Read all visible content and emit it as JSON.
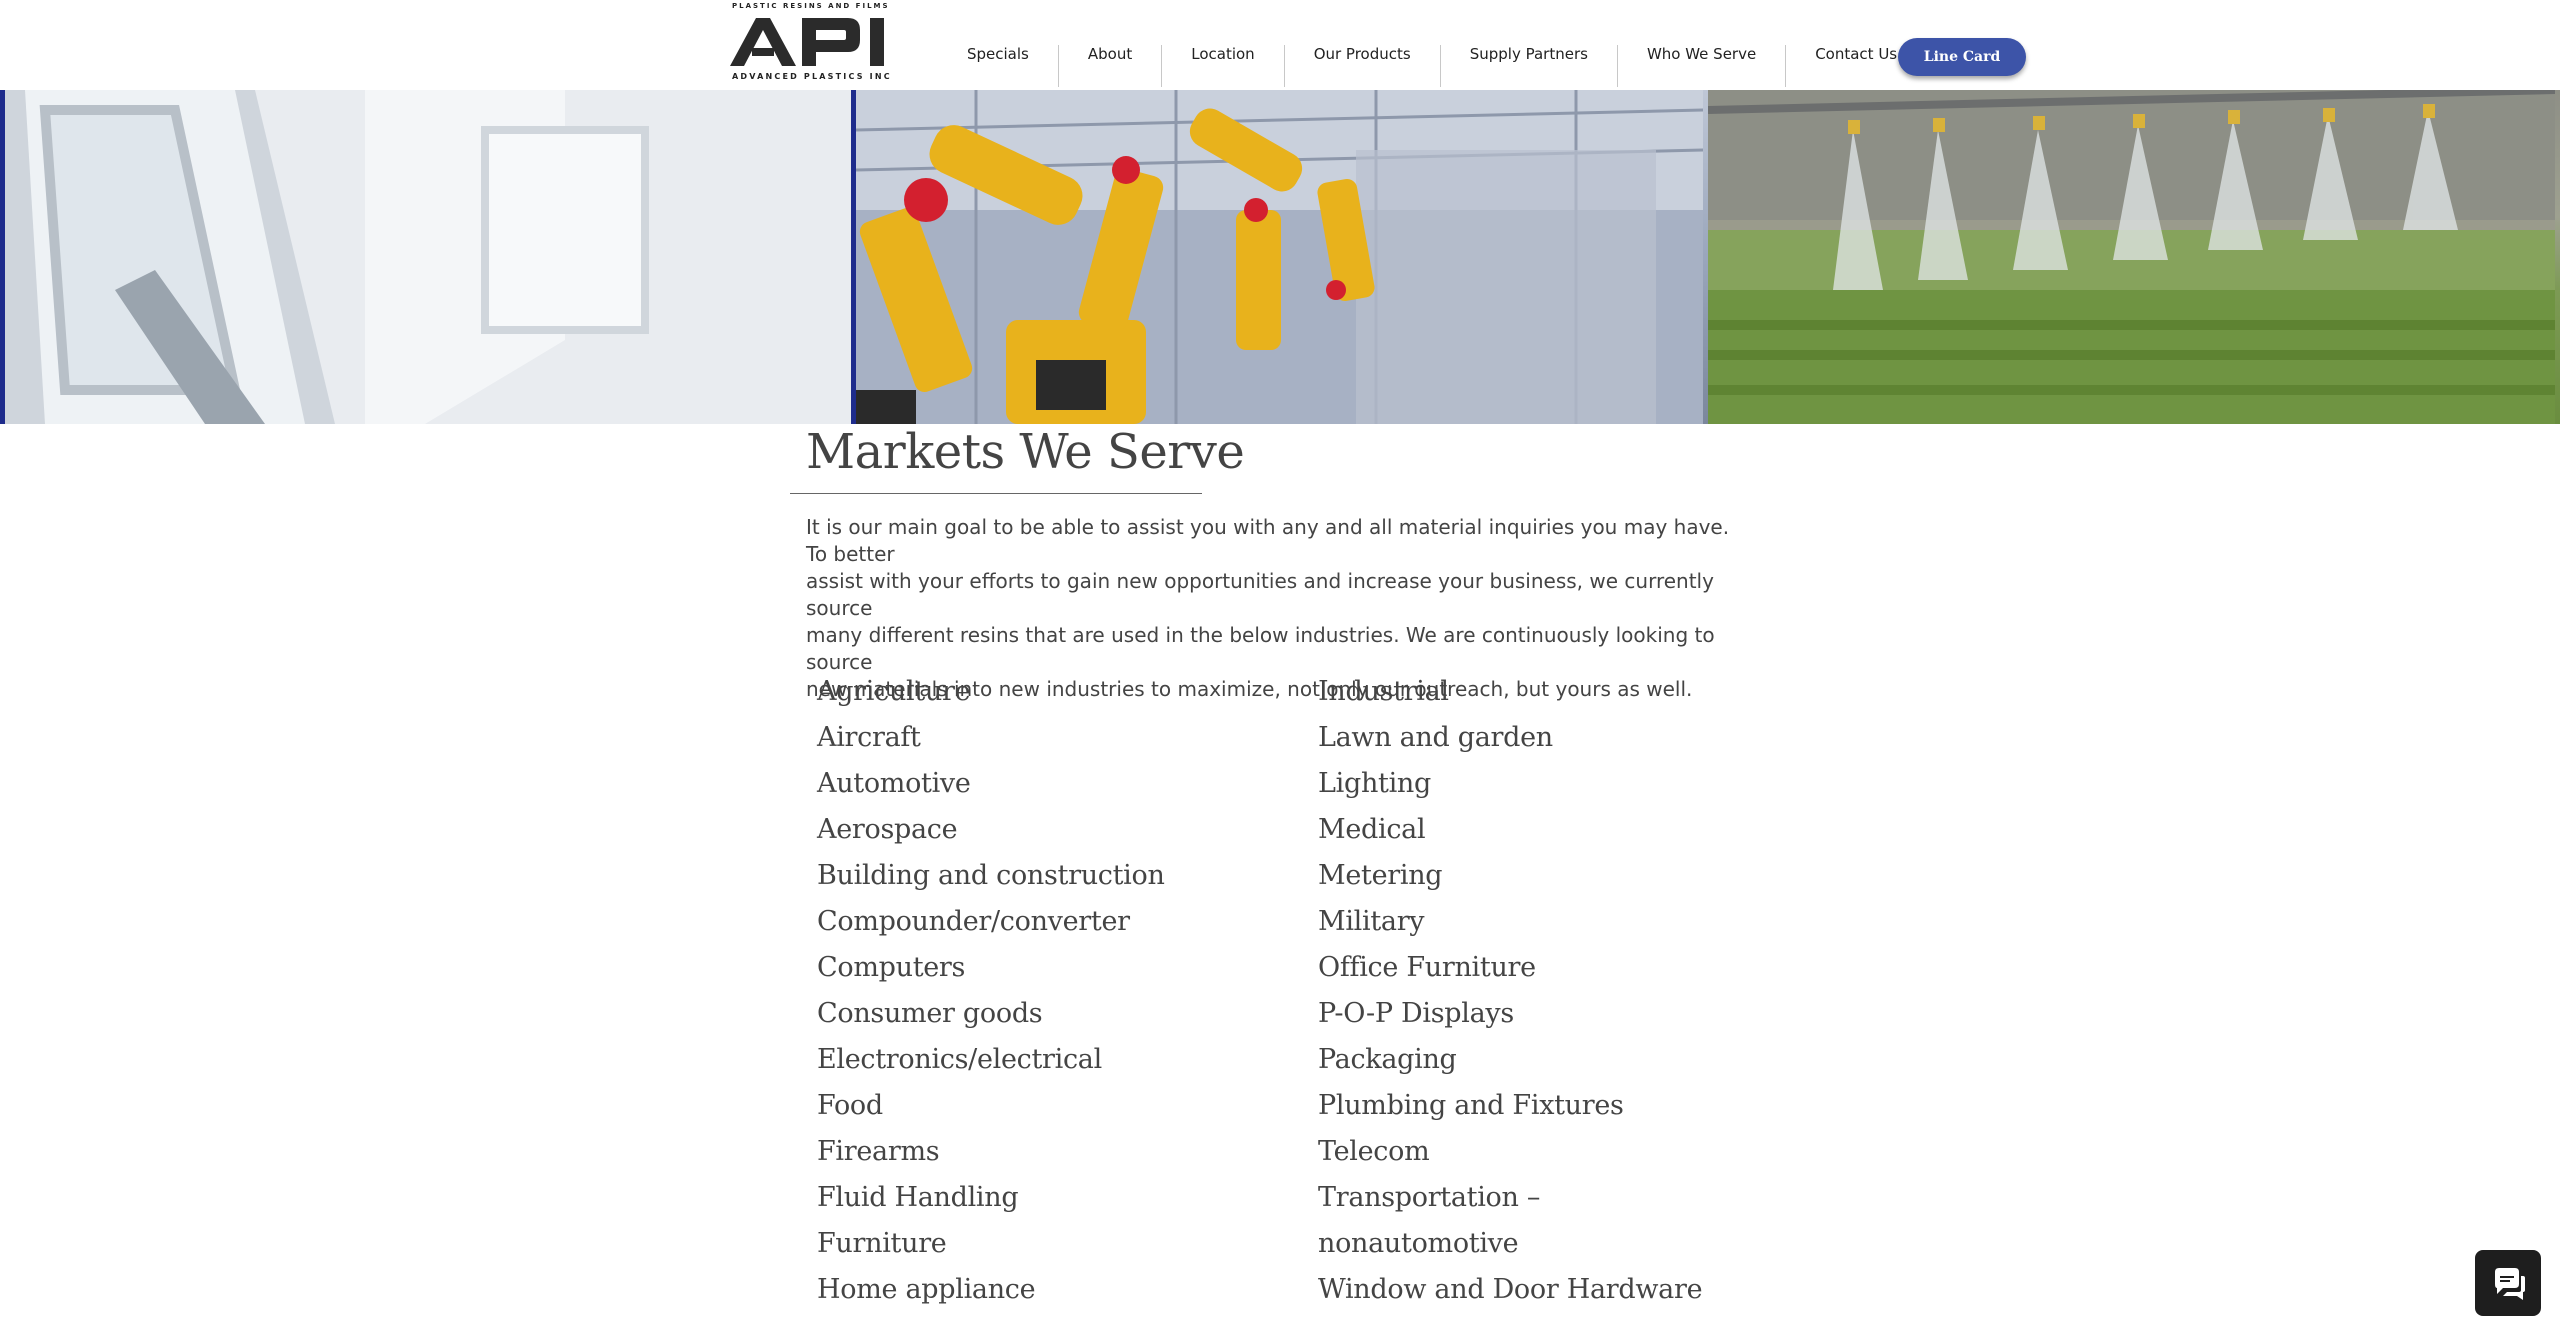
{
  "header": {
    "logo_tagline": "Plastic Resins and Films",
    "logo_text": "API",
    "logo_subtext": "Advanced Plastics Inc"
  },
  "nav": {
    "items": [
      {
        "label": "Specials"
      },
      {
        "label": "About"
      },
      {
        "label": "Location"
      },
      {
        "label": "Our Products"
      },
      {
        "label": "Supply Partners"
      },
      {
        "label": "Who We Serve"
      },
      {
        "label": "Contact Us"
      }
    ],
    "line_card_label": "Line Card"
  },
  "colors": {
    "accent_blue": "#3d54a8",
    "banner_border": "#1e2c8c",
    "text": "#444444",
    "chat_button": "#1e1e1e"
  },
  "banner": {
    "images": [
      "window-image",
      "robotic-assembly-image",
      "greenhouse-sprinkler-image"
    ]
  },
  "main": {
    "title": "Markets We Serve",
    "intro_lines": [
      "It is our main goal to be able to assist you with any and all material inquiries you may have. To better",
      "assist with your efforts to gain new opportunities and increase your business, we currently source",
      "many different resins that are used in the below industries. We are continuously looking to source",
      "new materials into new industries to maximize, not only our outreach, but yours as well."
    ],
    "markets_left": [
      "Agriculture",
      "Aircraft",
      "Automotive",
      "Aerospace",
      "Building and construction",
      "Compounder/converter",
      "Computers",
      "Consumer goods",
      "Electronics/electrical",
      "Food",
      "Firearms",
      "Fluid Handling",
      "Furniture",
      "Home appliance"
    ],
    "markets_right": [
      "Industrial",
      "Lawn and garden",
      "Lighting",
      "Medical",
      "Metering",
      "Military",
      "Office Furniture",
      "P-O-P Displays",
      "Packaging",
      "Plumbing and Fixtures",
      "Telecom",
      "Transportation –",
      "nonautomotive",
      "Window and Door Hardware"
    ]
  },
  "chat": {
    "icon": "chat-bubble-icon"
  }
}
